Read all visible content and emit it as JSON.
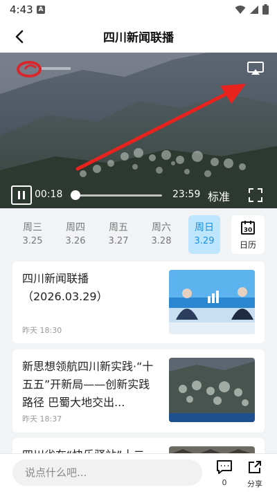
{
  "status_bar": {
    "time": "4:43",
    "notification_icon": "A"
  },
  "header": {
    "title": "四川新闻联播"
  },
  "player": {
    "current_time": "00:18",
    "total_time": "23:59",
    "quality_label": "标准",
    "progress": 0.0125
  },
  "dates": [
    {
      "weekday": "周三",
      "date": "3.25",
      "active": false
    },
    {
      "weekday": "周四",
      "date": "3.26",
      "active": false
    },
    {
      "weekday": "周五",
      "date": "3.27",
      "active": false
    },
    {
      "weekday": "周六",
      "date": "3.28",
      "active": false
    },
    {
      "weekday": "周日",
      "date": "3.29",
      "active": true
    }
  ],
  "calendar_label": "日历",
  "news": [
    {
      "title": "四川新闻联播（2026.03.29）",
      "time": "昨天 18:30",
      "thumb": "news-anchors"
    },
    {
      "title": "新思想领航四川新实践·“十五五”开新局——创新实践路径 巴蜀大地交出...",
      "time": "昨天 18:37",
      "thumb": "mountain-village"
    },
    {
      "title": "四川省在“快乐驿站”十二",
      "time": "",
      "thumb": "village-roofs"
    }
  ],
  "bottom": {
    "comment_placeholder": "说点什么吧...",
    "comment_count": "0",
    "share_label": "分享"
  },
  "colors": {
    "accent": "#1a8fe0",
    "active_bg": "#bfe6ff",
    "arrow": "#e8231e"
  }
}
